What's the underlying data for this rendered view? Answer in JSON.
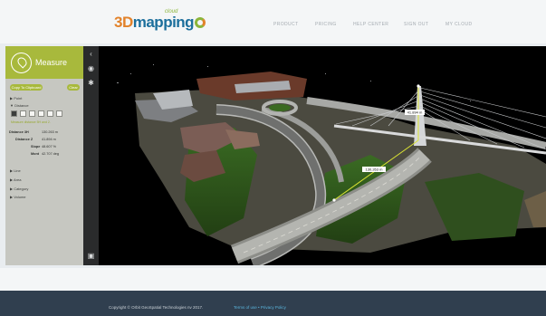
{
  "brand": {
    "name_3d": "3D",
    "name_map": "mapping",
    "name_cloud": "cloud"
  },
  "nav": {
    "product": "PRODUCT",
    "pricing": "PRICING",
    "help": "HELP CENTER",
    "signout": "SIGN OUT",
    "mycloud": "MY CLOUD"
  },
  "panel": {
    "title": "Measure",
    "copy_label": "Copy To Clipboard",
    "clear_label": "Clear",
    "point": "▶ Point",
    "distance": "▼ Distance",
    "hint": "Measure distance 5H and 2.",
    "measurements": [
      {
        "label": "Distance 3H",
        "value": "130.263 m"
      },
      {
        "label": "Distance Z",
        "value": "41.894 m"
      },
      {
        "label": "Slope",
        "value": "48.607 %"
      },
      {
        "label": "Mont",
        "value": "42.707 deg"
      }
    ],
    "line": "▶ Line",
    "area": "▶ Area",
    "category": "▶ Category",
    "volume": "▶ Volume"
  },
  "viewer": {
    "label_a": "41.894 m",
    "label_b": "130.263 m"
  },
  "footer": {
    "copyright": "Copyright © Orbit GeoSpatial Technologies nv 2017.",
    "terms": "Terms of use • Privacy Policy"
  },
  "colors": {
    "accent": "#a8b93c",
    "footer": "#303f4f",
    "toolbar": "#2a2b2c"
  }
}
